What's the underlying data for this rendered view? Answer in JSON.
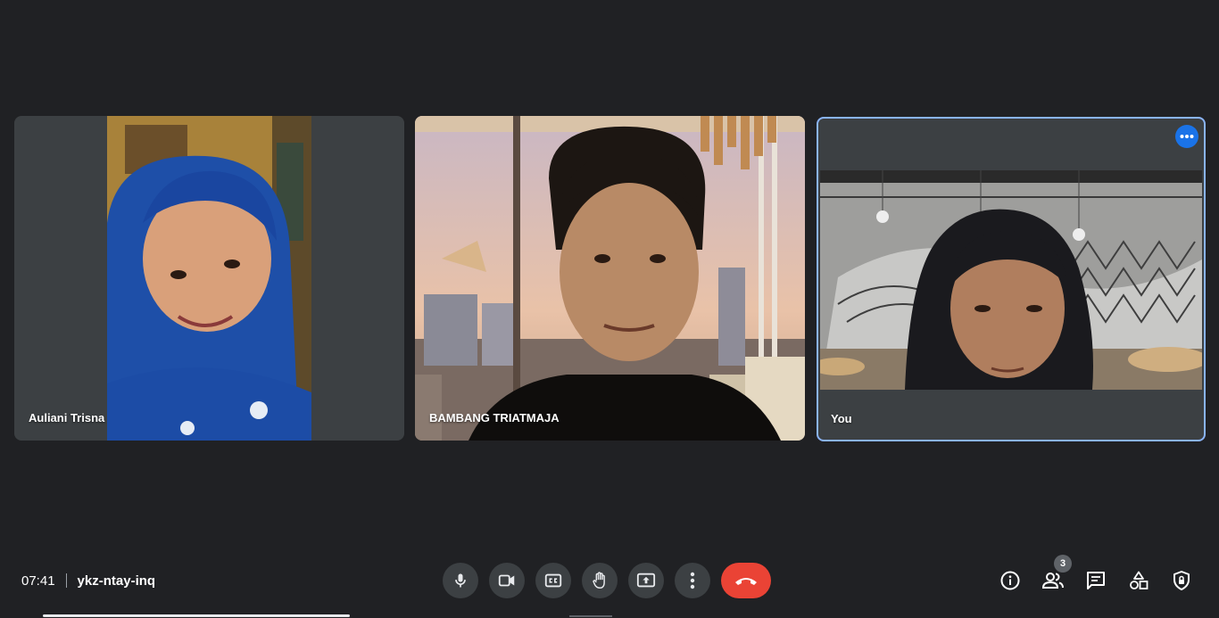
{
  "participants": [
    {
      "name": "Auliani Trisna",
      "video_alt": "Camera feed: woman wearing a blue hijab"
    },
    {
      "name": "BAMBANG TRIATMAJA",
      "video_alt": "Camera feed: man with a virtual city-view background"
    },
    {
      "name": "You",
      "video_alt": "Your camera feed: woman in a black hijab in a cafe",
      "active_speaker": true
    }
  ],
  "meeting": {
    "time": "07:41",
    "code": "ykz-ntay-inq"
  },
  "controls": {
    "mic": "mic-icon",
    "camera": "videocam-icon",
    "captions": "closed-captions-icon",
    "raise_hand": "hand-icon",
    "present": "present-screen-icon",
    "more": "more-vert-icon",
    "leave": "call-end-icon"
  },
  "side_panel": {
    "people_count": "3"
  },
  "colors": {
    "background": "#202124",
    "tile": "#3c4043",
    "active_border": "#8ab4f8",
    "accent": "#1a73e8",
    "leave": "#ea4335"
  }
}
